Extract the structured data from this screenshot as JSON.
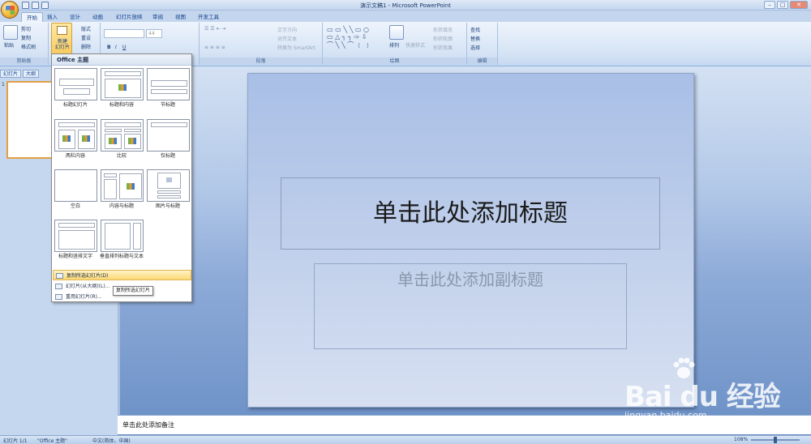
{
  "window": {
    "title": "演示文稿1 - Microsoft PowerPoint",
    "controls": [
      "–",
      "□",
      "✕"
    ]
  },
  "tabs": [
    "开始",
    "插入",
    "设计",
    "动画",
    "幻灯片放映",
    "审阅",
    "视图",
    "开发工具"
  ],
  "active_tab": "开始",
  "ribbon": {
    "clipboard": {
      "paste": "粘贴",
      "cut": "剪切",
      "copy": "复制",
      "format_painter": "格式刷",
      "label": "剪贴板"
    },
    "slides": {
      "new_slide": "新建\n幻灯片",
      "layout": "版式",
      "reset": "重设",
      "delete": "删除"
    },
    "font": {
      "size": "44"
    },
    "paragraph": {
      "text_direction": "文字方向",
      "align_text": "对齐文本",
      "convert_smartart": "转换为 SmartArt",
      "label": "段落"
    },
    "drawing": {
      "arrange": "排列",
      "quick_styles": "快速样式",
      "shape_fill": "形状填充",
      "shape_outline": "形状轮廓",
      "shape_effects": "形状效果",
      "label": "绘图"
    },
    "editing": {
      "find": "查找",
      "replace": "替换",
      "select": "选择",
      "label": "编辑"
    }
  },
  "panes": {
    "tab_slides": "幻灯片",
    "tab_outline": "大纲",
    "thumb_number": "1"
  },
  "slide": {
    "title": "单击此处添加标题",
    "subtitle": "单击此处添加副标题"
  },
  "notes": "单击此处添加备注",
  "dropdown": {
    "header": "Office 主题",
    "layouts": [
      "标题幻灯片",
      "标题和内容",
      "节标题",
      "两栏内容",
      "比较",
      "仅标题",
      "空白",
      "内容与标题",
      "图片与标题",
      "标题和竖排文字",
      "垂直排列标题与文本"
    ],
    "menu": [
      "复制所选幻灯片(D)",
      "幻灯片(从大纲)(L)...",
      "重用幻灯片(R)..."
    ],
    "tooltip": "复制所选幻灯片"
  },
  "status": {
    "slide": "幻灯片 1/1",
    "theme": "\"Office 主题\"",
    "language": "中文(简体，中国)",
    "zoom": "108%"
  },
  "watermark": {
    "brand": "Bai du 经验",
    "url": "jingyan.baidu.com"
  }
}
